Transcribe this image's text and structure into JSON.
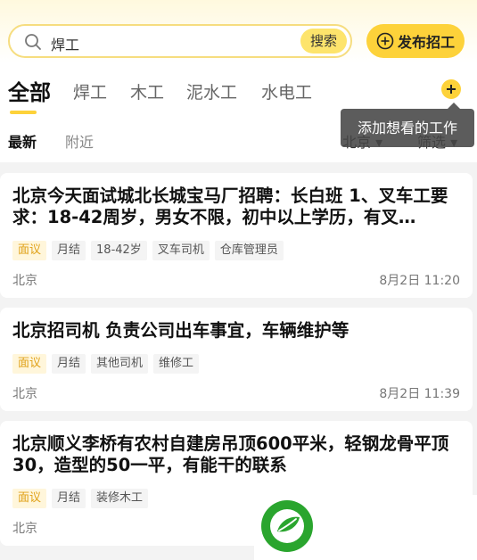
{
  "search": {
    "value": "焊工",
    "button_label": "搜索"
  },
  "publish_label": "发布招工",
  "tabs": [
    {
      "label": "全部"
    },
    {
      "label": "焊工"
    },
    {
      "label": "木工"
    },
    {
      "label": "泥水工"
    },
    {
      "label": "水电工"
    }
  ],
  "subtabs": {
    "latest": "最新",
    "nearby": "附近"
  },
  "filters": {
    "city": "北京",
    "filter": "筛选"
  },
  "tooltip": "添加想看的工作",
  "jobs": [
    {
      "title": "北京今天面试城北长城宝马厂招聘：长白班 1、叉车工要求：18-42周岁，男女不限，初中以上学历，有叉…",
      "tags": [
        "面议",
        "月结",
        "18-42岁",
        "叉车司机",
        "仓库管理员"
      ],
      "location": "北京",
      "time": "8月2日 11:20"
    },
    {
      "title": "北京招司机 负责公司出车事宜，车辆维护等",
      "tags": [
        "面议",
        "月结",
        "其他司机",
        "维修工"
      ],
      "location": "北京",
      "time": "8月2日 11:39"
    },
    {
      "title": "北京顺义李桥有农村自建房吊顶600平米，轻钢龙骨平顶30，造型的50一平，有能干的联系",
      "tags": [
        "面议",
        "月结",
        "装修木工"
      ],
      "location": "北京",
      "time": ""
    }
  ],
  "colors": {
    "accent": "#fdd23a",
    "highlight_tag_text": "#e0a21a",
    "logo_green": "#2aa52e"
  }
}
